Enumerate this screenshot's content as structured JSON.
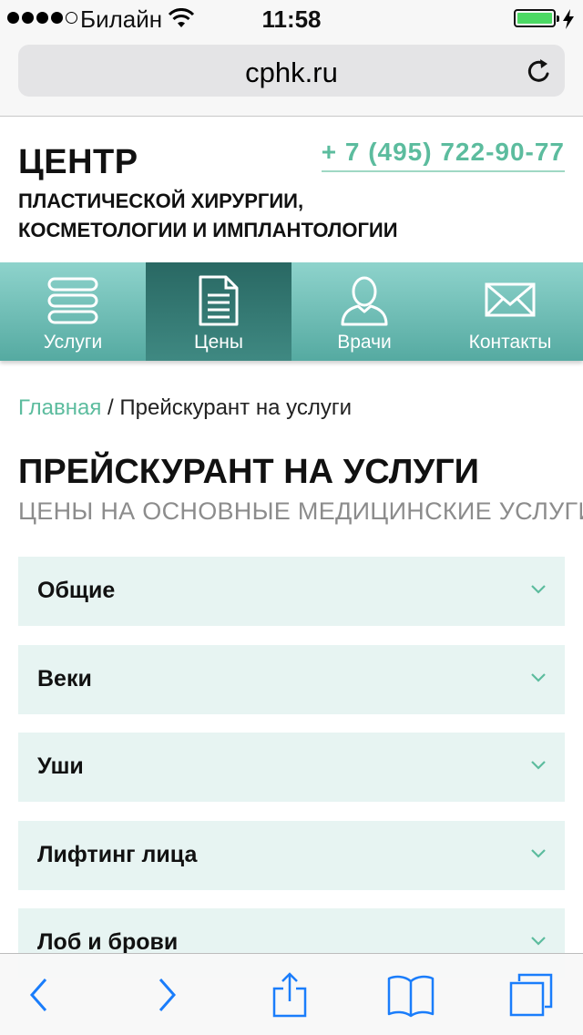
{
  "status_bar": {
    "carrier": "Билайн",
    "time": "11:58",
    "signal_bars": 4,
    "signal_total": 5,
    "battery_level": 1.0,
    "battery_color": "#4cd964"
  },
  "browser": {
    "url": "cphk.ru"
  },
  "site": {
    "title": "ЦЕНТР",
    "subtitle_line1": "ПЛАСТИЧЕСКОЙ ХИРУРГИИ,",
    "subtitle_line2": "КОСМЕТОЛОГИИ И ИМПЛАНТОЛОГИИ",
    "phone": "+ 7 (495) 722-90-77",
    "accent_color": "#5cbc9e"
  },
  "nav": {
    "items": [
      {
        "label": "Услуги",
        "icon": "services-list-icon",
        "active": false
      },
      {
        "label": "Цены",
        "icon": "document-icon",
        "active": true
      },
      {
        "label": "Врачи",
        "icon": "person-icon",
        "active": false
      },
      {
        "label": "Контакты",
        "icon": "envelope-icon",
        "active": false
      }
    ]
  },
  "breadcrumb": {
    "home": "Главная",
    "separator": "/",
    "current": "Прейскурант на услуги"
  },
  "page": {
    "title": "ПРЕЙСКУРАНТ НА УСЛУГИ",
    "subtitle": "ЦЕНЫ НА ОСНОВНЫЕ МЕДИЦИНСКИЕ УСЛУГИ"
  },
  "accordion": {
    "items": [
      {
        "label": "Общие"
      },
      {
        "label": "Веки"
      },
      {
        "label": "Уши"
      },
      {
        "label": "Лифтинг лица"
      },
      {
        "label": "Лоб и брови"
      }
    ]
  },
  "toolbar": {
    "icon_color": "#1a7dfb",
    "buttons": [
      "back-icon",
      "forward-icon",
      "share-icon",
      "bookmarks-icon",
      "tabs-icon"
    ]
  }
}
